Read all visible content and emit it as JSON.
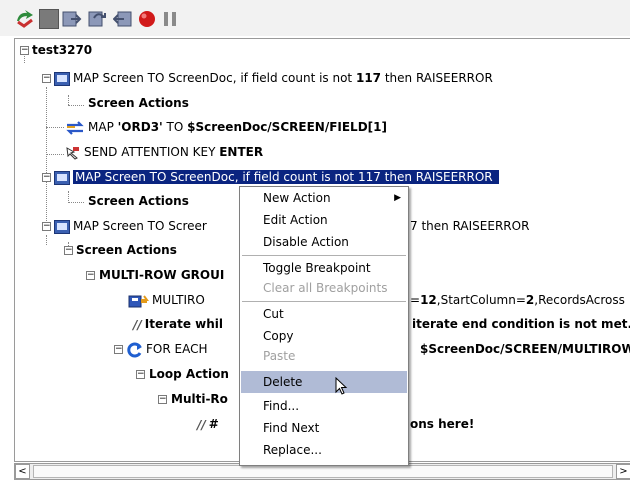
{
  "toolbar": {
    "buttons": [
      {
        "icon": "run-icon",
        "color": "#2e8b3c"
      },
      {
        "icon": "stop-icon",
        "color": "#7a7a7a"
      },
      {
        "icon": "step-into-icon",
        "color": "#6b7a99"
      },
      {
        "icon": "step-over-icon",
        "color": "#6b7a99"
      },
      {
        "icon": "step-out-icon",
        "color": "#6b7a99"
      },
      {
        "icon": "breakpoint-icon",
        "color": "#d11a1a"
      },
      {
        "icon": "pause-icon",
        "color": "#8a8a8a"
      }
    ]
  },
  "tree": {
    "root": "test3270",
    "r1": {
      "pre": "MAP Screen TO ScreenDoc, if field count is not ",
      "num": "117",
      "post": " then RAISEERROR"
    },
    "r2": "Screen Actions",
    "r3": {
      "pre": "MAP ",
      "bold": "'ORD3'",
      "mid": " TO ",
      "bold2": "$ScreenDoc/SCREEN/FIELD[1]"
    },
    "r4": {
      "pre": "SEND ATTENTION KEY ",
      "bold": "ENTER"
    },
    "r5": "MAP Screen TO ScreenDoc, if field count is not 117 then RAISEERROR",
    "r6": "Screen Actions",
    "r7": {
      "left": "MAP Screen TO Screer",
      "right": "7 then RAISEERROR"
    },
    "r8": "Screen Actions",
    "r9": "MULTI-ROW GROUI",
    "r10": {
      "left": "MULTIRO",
      "right_bold": "12",
      "right": ",StartColumn=",
      "right_bold2": "2",
      "right_end": ",RecordsAcross"
    },
    "r11": {
      "left": "Iterate whil",
      "right": "iterate end condition is not met."
    },
    "r12": {
      "left": "FOR EACH",
      "right": "$ScreenDoc/SCREEN/MULTIROW"
    },
    "r13": "Loop Action",
    "r14": "Multi-Ro",
    "r15": {
      "left": "#",
      "right": "ons here!"
    }
  },
  "context_menu": {
    "items": [
      {
        "label": "New Action",
        "has_submenu": true,
        "enabled": true
      },
      {
        "label": "Edit Action",
        "enabled": true
      },
      {
        "label": "Disable Action",
        "enabled": true
      },
      {
        "label": "Toggle Breakpoint",
        "enabled": true
      },
      {
        "label": "Clear all Breakpoints",
        "enabled": false
      },
      {
        "label": "Cut",
        "enabled": true
      },
      {
        "label": "Copy",
        "enabled": true
      },
      {
        "label": "Paste",
        "enabled": false
      },
      {
        "label": "Delete",
        "enabled": true,
        "highlighted": true
      },
      {
        "label": "Find...",
        "enabled": true
      },
      {
        "label": "Find Next",
        "enabled": true
      },
      {
        "label": "Replace...",
        "enabled": true
      }
    ]
  },
  "colors": {
    "selection": "#0a2480",
    "menu_highlight": "#b0bbd6"
  }
}
